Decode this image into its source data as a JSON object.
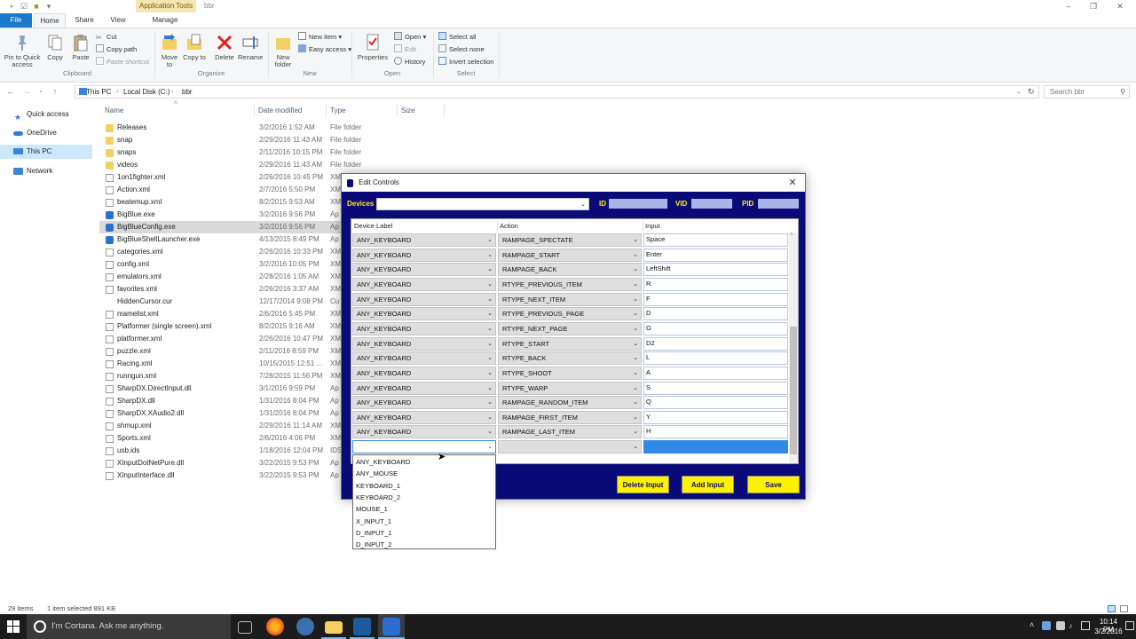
{
  "window": {
    "context_tab": "Application Tools",
    "title": "bbr"
  },
  "tabs": [
    "File",
    "Home",
    "Share",
    "View",
    "Manage"
  ],
  "ribbon": {
    "clipboard": {
      "pin": "Pin to Quick access",
      "copy": "Copy",
      "paste": "Paste",
      "cut": "Cut",
      "copy_path": "Copy path",
      "paste_shortcut": "Paste shortcut",
      "group": "Clipboard"
    },
    "organize": {
      "move_to": "Move to",
      "copy_to": "Copy to",
      "delete": "Delete",
      "rename": "Rename",
      "group": "Organize"
    },
    "new": {
      "new_folder": "New folder",
      "new_item": "New item",
      "easy_access": "Easy access",
      "group": "New"
    },
    "open": {
      "properties": "Properties",
      "open": "Open",
      "edit": "Edit",
      "history": "History",
      "group": "Open"
    },
    "select": {
      "select_all": "Select all",
      "select_none": "Select none",
      "invert": "Invert selection",
      "group": "Select"
    }
  },
  "address": {
    "crumbs": [
      "This PC",
      "Local Disk (C:)",
      "bbr"
    ],
    "search_placeholder": "Search bbr"
  },
  "nav": [
    "Quick access",
    "OneDrive",
    "This PC",
    "Network"
  ],
  "columns": {
    "name": "Name",
    "date": "Date modified",
    "type": "Type",
    "size": "Size"
  },
  "files": [
    {
      "name": "Releases",
      "date": "3/2/2016 1:52 AM",
      "type": "File folder",
      "kind": "folder"
    },
    {
      "name": "snap",
      "date": "2/29/2016 11:43 AM",
      "type": "File folder",
      "kind": "folder"
    },
    {
      "name": "snaps",
      "date": "2/11/2016 10:15 PM",
      "type": "File folder",
      "kind": "folder"
    },
    {
      "name": "videos",
      "date": "2/29/2016 11:43 AM",
      "type": "File folder",
      "kind": "folder"
    },
    {
      "name": "1on1fighter.xml",
      "date": "2/26/2016 10:45 PM",
      "type": "XM",
      "kind": "file"
    },
    {
      "name": "Action.xml",
      "date": "2/7/2016 5:50 PM",
      "type": "XM",
      "kind": "file"
    },
    {
      "name": "beatemup.xml",
      "date": "8/2/2015 9:53 AM",
      "type": "XM",
      "kind": "file"
    },
    {
      "name": "BigBlue.exe",
      "date": "3/2/2016 9:56 PM",
      "type": "Ap",
      "kind": "exe"
    },
    {
      "name": "BigBlueConfig.exe",
      "date": "3/2/2016 9:56 PM",
      "type": "Ap",
      "kind": "exe"
    },
    {
      "name": "BigBlueShellLauncher.exe",
      "date": "4/13/2015 8:49 PM",
      "type": "Ap",
      "kind": "exe"
    },
    {
      "name": "categories.xml",
      "date": "2/26/2016 10:33 PM",
      "type": "XM",
      "kind": "file"
    },
    {
      "name": "config.xml",
      "date": "3/2/2016 10:05 PM",
      "type": "XM",
      "kind": "file"
    },
    {
      "name": "emulators.xml",
      "date": "2/28/2016 1:05 AM",
      "type": "XM",
      "kind": "file"
    },
    {
      "name": "favorites.xml",
      "date": "2/26/2016 3:37 AM",
      "type": "XM",
      "kind": "file"
    },
    {
      "name": "HiddenCursor.cur",
      "date": "12/17/2014 9:08 PM",
      "type": "Cu",
      "kind": "cur"
    },
    {
      "name": "mamelist.xml",
      "date": "2/6/2016 5:45 PM",
      "type": "XM",
      "kind": "file"
    },
    {
      "name": "Platformer (single screen).xml",
      "date": "8/2/2015 9:16 AM",
      "type": "XM",
      "kind": "file"
    },
    {
      "name": "platformer.xml",
      "date": "2/26/2016 10:47 PM",
      "type": "XM",
      "kind": "file"
    },
    {
      "name": "puzzle.xml",
      "date": "2/11/2016 8:59 PM",
      "type": "XM",
      "kind": "file"
    },
    {
      "name": "Racing.xml",
      "date": "10/15/2015 12:51 ...",
      "type": "XM",
      "kind": "file"
    },
    {
      "name": "runngun.xml",
      "date": "7/28/2015 11:56 PM",
      "type": "XM",
      "kind": "file"
    },
    {
      "name": "SharpDX.DirectInput.dll",
      "date": "3/1/2016 9:59 PM",
      "type": "Ap",
      "kind": "dll"
    },
    {
      "name": "SharpDX.dll",
      "date": "1/31/2016 8:04 PM",
      "type": "Ap",
      "kind": "dll"
    },
    {
      "name": "SharpDX.XAudio2.dll",
      "date": "1/31/2016 8:04 PM",
      "type": "Ap",
      "kind": "dll"
    },
    {
      "name": "shmup.xml",
      "date": "2/29/2016 11:14 AM",
      "type": "XM",
      "kind": "file"
    },
    {
      "name": "Sports.xml",
      "date": "2/6/2016 4:06 PM",
      "type": "XM",
      "kind": "file"
    },
    {
      "name": "usb.ids",
      "date": "1/18/2016 12:04 PM",
      "type": "IDS",
      "kind": "file"
    },
    {
      "name": "XInputDotNetPure.dll",
      "date": "3/22/2015 9:53 PM",
      "type": "Ap",
      "kind": "dll"
    },
    {
      "name": "XInputInterface.dll",
      "date": "3/22/2015 9:53 PM",
      "type": "Ap",
      "kind": "dll"
    }
  ],
  "status": {
    "items": "29 items",
    "selected": "1 item selected  891 KB"
  },
  "taskbar": {
    "cortana": "I'm Cortana. Ask me anything.",
    "time": "10:14 PM",
    "date": "3/2/2016"
  },
  "dialog": {
    "title": "Edit Controls",
    "devices_label": "Devices",
    "id_label": "ID",
    "vid_label": "VID",
    "pid_label": "PID",
    "headers": {
      "device": "Device Label",
      "action": "Action",
      "input": "Input"
    },
    "rows": [
      {
        "device": "ANY_KEYBOARD",
        "action": "RAMPAGE_SPECTATE",
        "input": "Space"
      },
      {
        "device": "ANY_KEYBOARD",
        "action": "RAMPAGE_START",
        "input": "Enter"
      },
      {
        "device": "ANY_KEYBOARD",
        "action": "RAMPAGE_BACK",
        "input": "LeftShift"
      },
      {
        "device": "ANY_KEYBOARD",
        "action": "RTYPE_PREVIOUS_ITEM",
        "input": "R"
      },
      {
        "device": "ANY_KEYBOARD",
        "action": "RTYPE_NEXT_ITEM",
        "input": "F"
      },
      {
        "device": "ANY_KEYBOARD",
        "action": "RTYPE_PREVIOUS_PAGE",
        "input": "D"
      },
      {
        "device": "ANY_KEYBOARD",
        "action": "RTYPE_NEXT_PAGE",
        "input": "G"
      },
      {
        "device": "ANY_KEYBOARD",
        "action": "RTYPE_START",
        "input": "D2"
      },
      {
        "device": "ANY_KEYBOARD",
        "action": "RTYPE_BACK",
        "input": "L"
      },
      {
        "device": "ANY_KEYBOARD",
        "action": "RTYPE_SHOOT",
        "input": "A"
      },
      {
        "device": "ANY_KEYBOARD",
        "action": "RTYPE_WARP",
        "input": "S"
      },
      {
        "device": "ANY_KEYBOARD",
        "action": "RAMPAGE_RANDOM_ITEM",
        "input": "Q"
      },
      {
        "device": "ANY_KEYBOARD",
        "action": "RAMPAGE_FIRST_ITEM",
        "input": "Y"
      },
      {
        "device": "ANY_KEYBOARD",
        "action": "RAMPAGE_LAST_ITEM",
        "input": "H"
      }
    ],
    "dropdown_options": [
      "ANY_KEYBOARD",
      "ANY_MOUSE",
      "KEYBOARD_1",
      "KEYBOARD_2",
      "MOUSE_1",
      "X_INPUT_1",
      "D_INPUT_1",
      "D_INPUT_2"
    ],
    "buttons": {
      "delete": "Delete Input",
      "add": "Add Input",
      "save": "Save"
    }
  }
}
